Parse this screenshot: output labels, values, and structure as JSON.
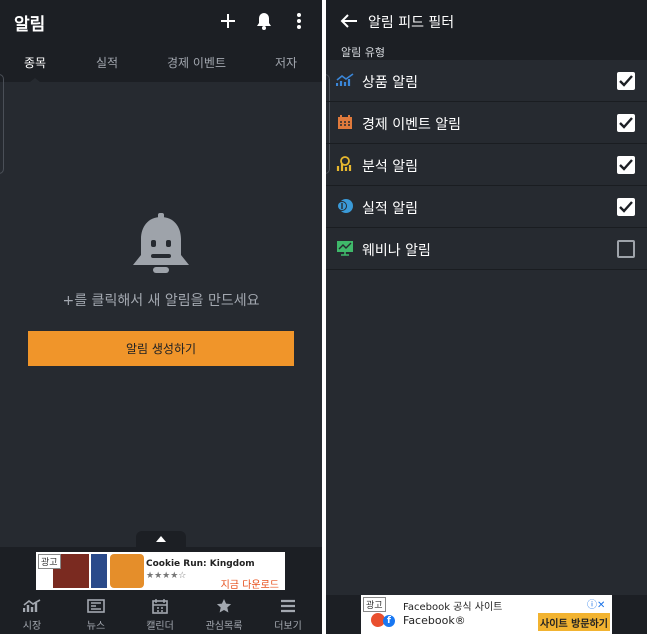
{
  "left": {
    "header": {
      "title": "알림"
    },
    "tabs": [
      {
        "label": "종목",
        "active": true
      },
      {
        "label": "실적",
        "active": false
      },
      {
        "label": "경제 이벤트",
        "active": false
      },
      {
        "label": "저자",
        "active": false
      }
    ],
    "empty_state": {
      "icon": "bell-sad-icon",
      "message": "+를 클릭해서 새 알림을 만드세요",
      "create_button": "알림 생성하기"
    },
    "ad": {
      "label": "광고",
      "title": "Cookie Run: Kingdom",
      "rating": "★★★★☆",
      "cta": "지금 다운로드"
    },
    "bottom_nav": [
      {
        "label": "시장",
        "icon": "chart-icon"
      },
      {
        "label": "뉴스",
        "icon": "news-icon"
      },
      {
        "label": "캘린더",
        "icon": "calendar-icon"
      },
      {
        "label": "관심목록",
        "icon": "star-icon"
      },
      {
        "label": "더보기",
        "icon": "menu-icon"
      }
    ]
  },
  "right": {
    "header": {
      "title": "알림 피드 필터"
    },
    "section_label": "알림 유형",
    "filters": [
      {
        "label": "상품 알림",
        "checked": true,
        "icon": "trend-up-icon",
        "color": "#3a86d8"
      },
      {
        "label": "경제 이벤트 알림",
        "checked": true,
        "icon": "calendar-icon",
        "color": "#e07a3c"
      },
      {
        "label": "분석 알림",
        "checked": true,
        "icon": "analysis-icon",
        "color": "#e8b82e"
      },
      {
        "label": "실적 알림",
        "checked": true,
        "icon": "earnings-icon",
        "color": "#3a9ad8"
      },
      {
        "label": "웨비나 알림",
        "checked": false,
        "icon": "webinar-icon",
        "color": "#3fb86a"
      }
    ],
    "ad": {
      "label": "광고",
      "title": "Facebook 공식 사이트",
      "subtitle": "Facebook®",
      "cta": "사이트 방문하기",
      "close": "ⓘ✕"
    }
  },
  "colors": {
    "accent": "#f0952a",
    "background": "#262a30",
    "bar": "#1c1f24"
  }
}
